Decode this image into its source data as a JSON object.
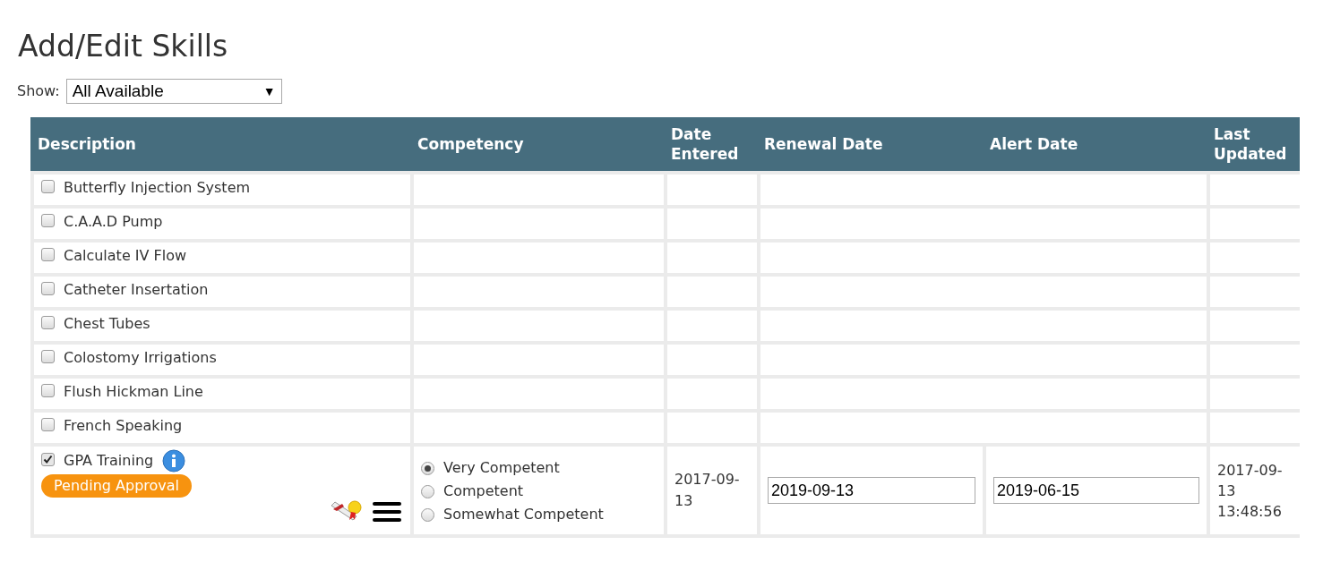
{
  "title": "Add/Edit Skills",
  "filter": {
    "label": "Show:",
    "value": "All Available",
    "arrow": "▼"
  },
  "table": {
    "columns": [
      "Description",
      "Competency",
      "Date Entered",
      "Renewal Date",
      "Alert Date",
      "Last Updated"
    ],
    "rows": [
      {
        "kind": "simple",
        "description": "Butterfly Injection System",
        "checked": false
      },
      {
        "kind": "simple",
        "description": "C.A.A.D Pump",
        "checked": false
      },
      {
        "kind": "simple",
        "description": "Calculate IV Flow",
        "checked": false
      },
      {
        "kind": "simple",
        "description": "Catheter Insertation",
        "checked": false
      },
      {
        "kind": "simple",
        "description": "Chest Tubes",
        "checked": false
      },
      {
        "kind": "simple",
        "description": "Colostomy Irrigations",
        "checked": false
      },
      {
        "kind": "simple",
        "description": "Flush Hickman Line",
        "checked": false
      },
      {
        "kind": "simple",
        "description": "French Speaking",
        "checked": false
      },
      {
        "kind": "detail",
        "description": "GPA Training",
        "checked": true,
        "badge": "Pending Approval",
        "competency": [
          {
            "label": "Very Competent",
            "selected": true
          },
          {
            "label": "Competent",
            "selected": false
          },
          {
            "label": "Somewhat Competent",
            "selected": false
          }
        ],
        "date_entered": "2017-09-13",
        "renewal_date": "2019-09-13",
        "alert_date": "2019-06-15",
        "last_updated": "2017-09-13 13:48:56"
      }
    ]
  }
}
